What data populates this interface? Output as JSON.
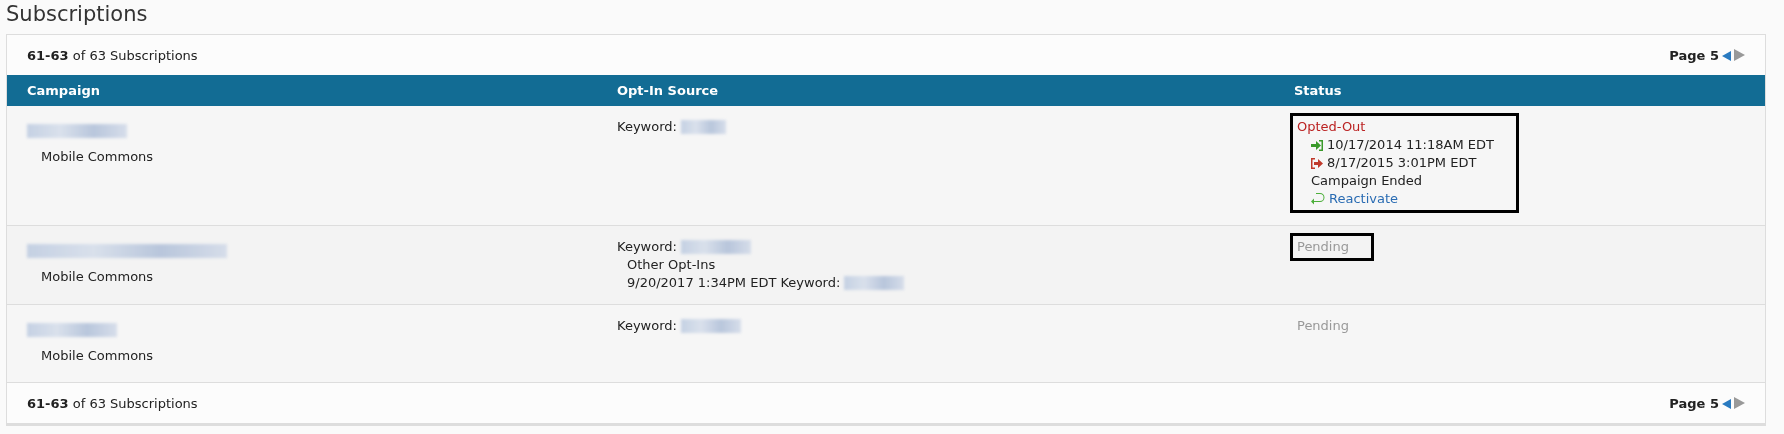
{
  "title": "Subscriptions",
  "summary": {
    "range": "61-63",
    "rest": "of 63 Subscriptions"
  },
  "pager": {
    "label": "Page 5",
    "prev_disabled": false,
    "next_disabled": true
  },
  "table": {
    "columns": [
      "Campaign",
      "Opt-In Source",
      "Status"
    ],
    "rows": [
      {
        "campaign": {
          "kind": "redacted",
          "owner": "Mobile Commons"
        },
        "source": {
          "keyword_label": "Keyword:"
        },
        "status": {
          "kind": "opted-out",
          "label": "Opted-Out",
          "opt_in": "10/17/2014 11:18AM EDT",
          "opt_out": "8/17/2015 3:01PM EDT",
          "note": "Campaign Ended",
          "action": "Reactivate",
          "highlighted": true
        }
      },
      {
        "campaign": {
          "kind": "redacted",
          "owner": "Mobile Commons"
        },
        "source": {
          "keyword_label": "Keyword:",
          "other_label": "Other Opt-Ins",
          "other_line": "9/20/2017 1:34PM EDT Keyword:"
        },
        "status": {
          "kind": "pending",
          "label": "Pending",
          "highlighted": true
        }
      },
      {
        "campaign": {
          "kind": "redacted",
          "owner": "Mobile Commons"
        },
        "source": {
          "keyword_label": "Keyword:"
        },
        "status": {
          "kind": "pending",
          "label": "Pending",
          "highlighted": false
        }
      }
    ]
  },
  "footer": {
    "range": "61-63",
    "rest": "of 63 Subscriptions",
    "pager_label": "Page 5"
  }
}
